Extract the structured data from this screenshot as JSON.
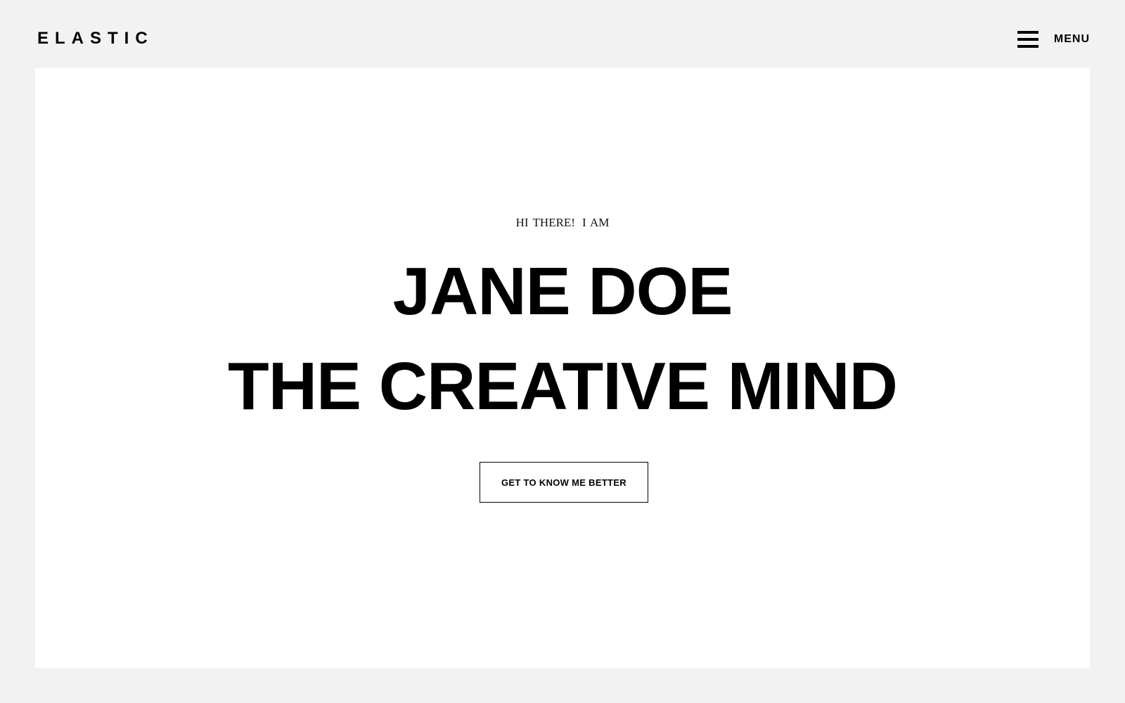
{
  "header": {
    "logo": "ELASTIC",
    "menu_label": "MENU",
    "menu_icon": "hamburger-icon"
  },
  "hero": {
    "greeting_part1": "HI THERE!",
    "greeting_part2": "I AM",
    "name": "JANE DOE",
    "tagline": "THE CREATIVE MIND",
    "cta_label": "GET TO KNOW ME BETTER"
  },
  "colors": {
    "page_background": "#f2f2f2",
    "hero_background": "#ffffff",
    "text": "#000000"
  }
}
